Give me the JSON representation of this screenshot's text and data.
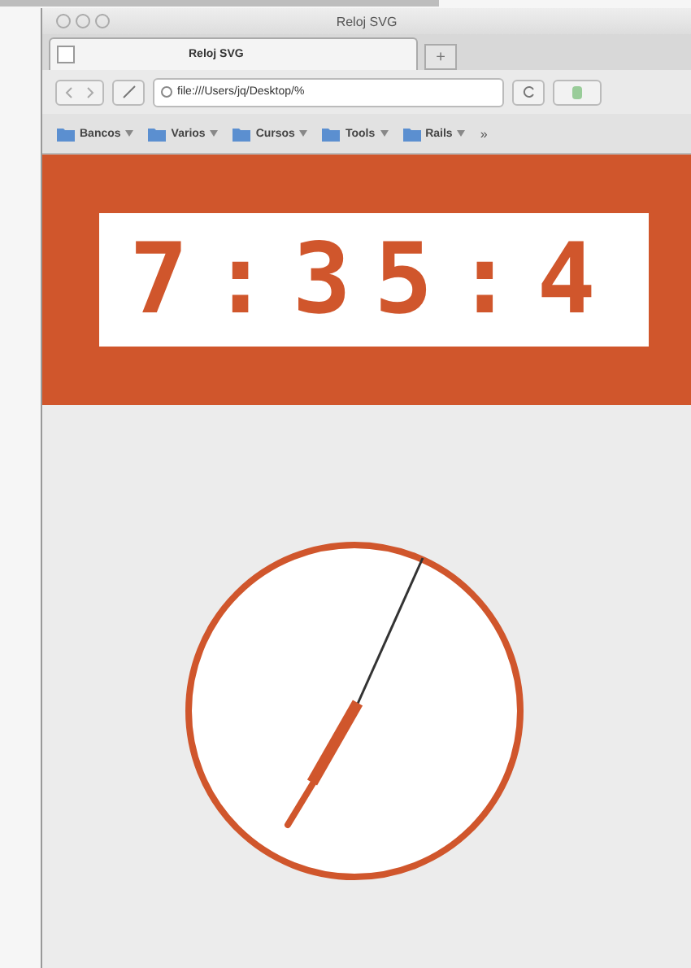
{
  "window": {
    "title": "Reloj SVG"
  },
  "tabs": [
    {
      "label": "Reloj SVG",
      "selected": true
    }
  ],
  "new_tab": "+",
  "address_bar": {
    "value": "file:///Users/jq/Desktop/%"
  },
  "bookmarks": [
    {
      "label": "Bancos"
    },
    {
      "label": "Varios"
    },
    {
      "label": "Cursos"
    },
    {
      "label": "Tools"
    },
    {
      "label": "Rails"
    }
  ],
  "bookmarks_overflow": "»",
  "digital_clock": {
    "time": "7:35:4"
  }
}
